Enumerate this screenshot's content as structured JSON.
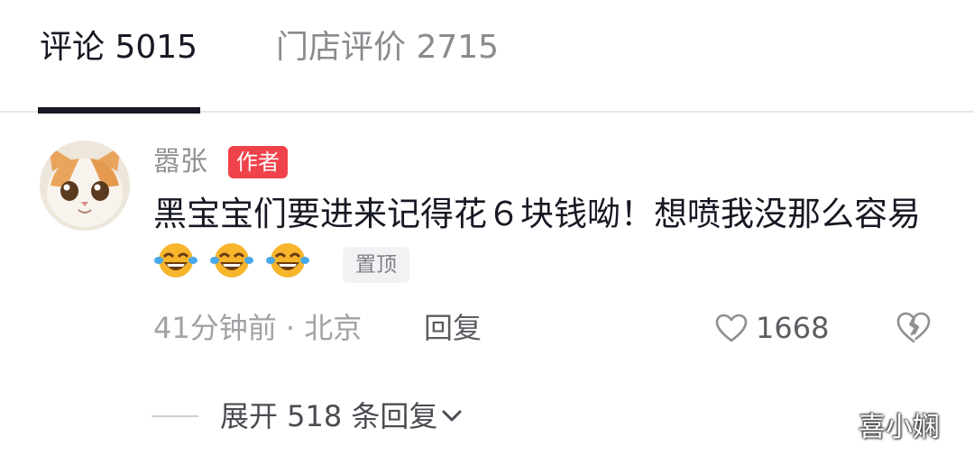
{
  "tabs": [
    {
      "label": "评论 5015",
      "active": true
    },
    {
      "label": "门店评价 2715",
      "active": false
    }
  ],
  "comment": {
    "avatar_icon": "cat-avatar-icon",
    "username": "嚣张",
    "author_badge": "作者",
    "text": "黑宝宝们要进来记得花６块钱呦！想喷我没那么容易",
    "emojis": [
      "laughing-tears-emoji",
      "laughing-tears-emoji",
      "laughing-tears-emoji"
    ],
    "pinned_badge": "置顶",
    "meta": "41分钟前 · 北京",
    "reply_label": "回复",
    "like_count": "1668"
  },
  "expand_replies": {
    "label": "展开 518 条回复"
  },
  "watermark": "喜小娴",
  "colors": {
    "author_badge": "#f0424a",
    "emoji_face": "#f7b52c",
    "text_primary": "#161823",
    "text_secondary": "#a1a1a6"
  }
}
